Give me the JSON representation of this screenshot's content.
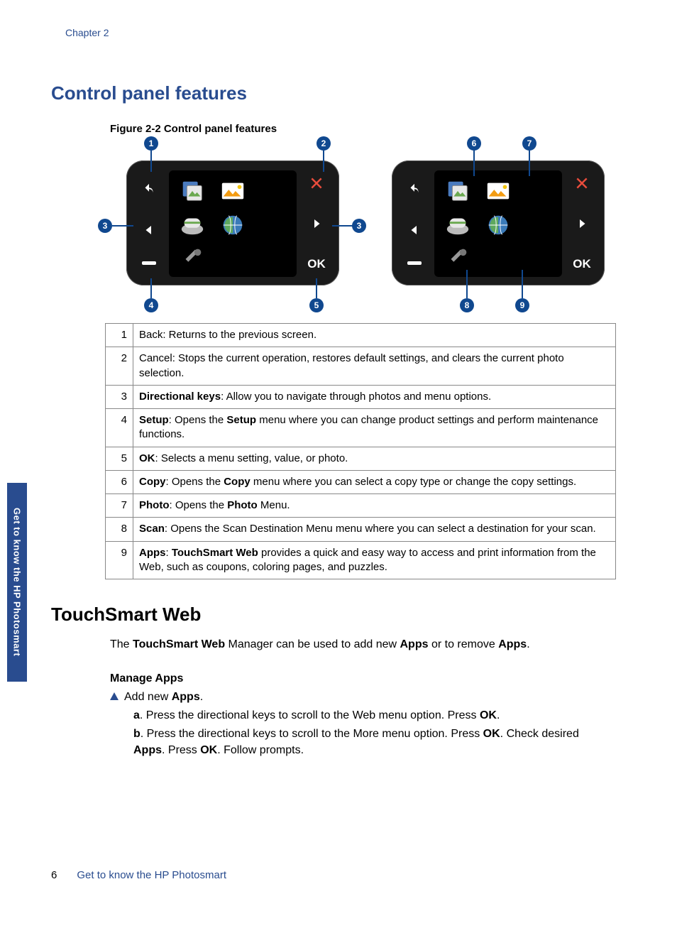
{
  "chapter_label": "Chapter 2",
  "side_tab_text": "Get to know the HP Photosmart",
  "section_cp": "Control panel features",
  "figure_caption": "Figure 2-2 Control panel features",
  "ok_label": "OK",
  "callouts": {
    "n1": "1",
    "n2": "2",
    "n3": "3",
    "n3b": "3",
    "n4": "4",
    "n5": "5",
    "n6": "6",
    "n7": "7",
    "n8": "8",
    "n9": "9"
  },
  "table": {
    "r1n": "1",
    "r1": "Back: Returns to the previous screen.",
    "r2n": "2",
    "r2": "Cancel: Stops the current operation, restores default settings, and clears the current photo selection.",
    "r3n": "3",
    "r3b": "Directional keys",
    "r3": ": Allow you to navigate through photos and menu options.",
    "r4n": "4",
    "r4b1": "Setup",
    "r4m": ": Opens the ",
    "r4b2": "Setup",
    "r4": " menu where you can change product settings and perform maintenance functions.",
    "r5n": "5",
    "r5b": "OK",
    "r5": ": Selects a menu setting, value, or photo.",
    "r6n": "6",
    "r6b1": "Copy",
    "r6m": ": Opens the ",
    "r6b2": "Copy",
    "r6": " menu where you can select a copy type or change the copy settings.",
    "r7n": "7",
    "r7b1": "Photo",
    "r7m": ": Opens the ",
    "r7b2": "Photo",
    "r7": " Menu.",
    "r8n": "8",
    "r8b": "Scan",
    "r8": ": Opens the Scan Destination Menu menu where you can select a destination for your scan.",
    "r9n": "9",
    "r9b1": "Apps",
    "r9m": ": ",
    "r9b2": "TouchSmart Web",
    "r9": " provides a quick and easy way to access and print information from the Web, such as coupons, coloring pages, and puzzles."
  },
  "section_ts": "TouchSmart Web",
  "ts_intro_pre": "The ",
  "ts_intro_b1": "TouchSmart Web",
  "ts_intro_mid": " Manager can be used to add new ",
  "ts_intro_b2": "Apps",
  "ts_intro_mid2": " or to remove ",
  "ts_intro_b3": "Apps",
  "ts_intro_end": ".",
  "manage_sub": "Manage Apps",
  "add_pre": "Add new ",
  "add_b": "Apps",
  "add_end": ".",
  "step_a_label": "a",
  "step_a_pre": ".   Press the directional keys to scroll to the Web menu option. Press ",
  "step_a_b": "OK",
  "step_a_end": ".",
  "step_b_label": "b",
  "step_b_pre": ".   Press the directional keys to scroll to the More menu option. Press ",
  "step_b_b1": "OK",
  "step_b_mid": ". Check desired ",
  "step_b_b2": "Apps",
  "step_b_mid2": ". Press ",
  "step_b_b3": "OK",
  "step_b_end": ". Follow prompts.",
  "footer_page": "6",
  "footer_text": "Get to know the HP Photosmart"
}
